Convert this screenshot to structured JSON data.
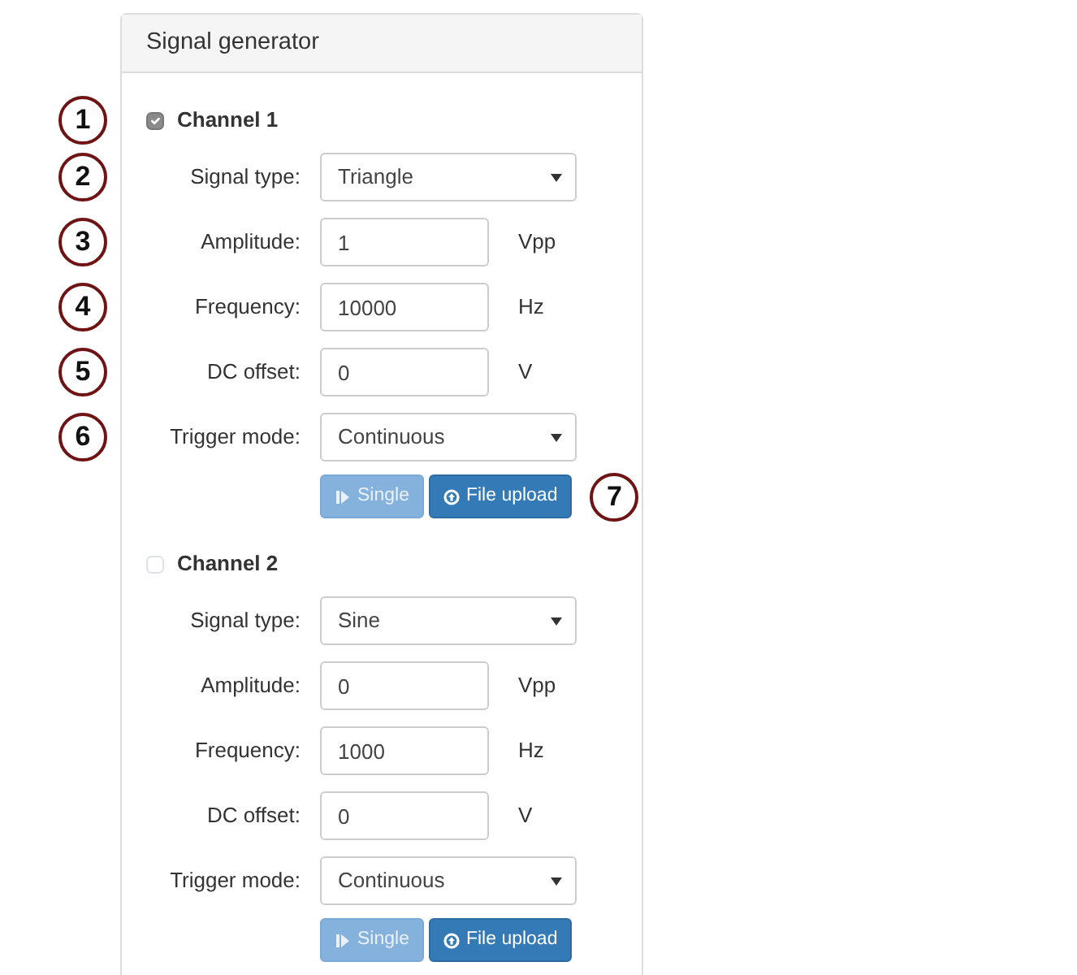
{
  "panel": {
    "title": "Signal generator"
  },
  "channels": [
    {
      "label": "Channel 1",
      "checked": true,
      "callout": "1",
      "fields": [
        {
          "kind": "select",
          "label": "Signal type:",
          "value": "Triangle",
          "callout": "2"
        },
        {
          "kind": "input",
          "label": "Amplitude:",
          "value": "1",
          "unit": "Vpp",
          "callout": "3"
        },
        {
          "kind": "input",
          "label": "Frequency:",
          "value": "10000",
          "unit": "Hz",
          "callout": "4"
        },
        {
          "kind": "input",
          "label": "DC offset:",
          "value": "0",
          "unit": "V",
          "callout": "5"
        },
        {
          "kind": "select",
          "label": "Trigger mode:",
          "value": "Continuous",
          "callout": "6"
        }
      ],
      "buttons": [
        {
          "kind": "single",
          "label": "Single",
          "disabled": true
        },
        {
          "kind": "upload",
          "label": "File upload",
          "disabled": false
        }
      ],
      "buttons_callout": "7"
    },
    {
      "label": "Channel 2",
      "checked": false,
      "fields": [
        {
          "kind": "select",
          "label": "Signal type:",
          "value": "Sine"
        },
        {
          "kind": "input",
          "label": "Amplitude:",
          "value": "0",
          "unit": "Vpp"
        },
        {
          "kind": "input",
          "label": "Frequency:",
          "value": "1000",
          "unit": "Hz"
        },
        {
          "kind": "input",
          "label": "DC offset:",
          "value": "0",
          "unit": "V"
        },
        {
          "kind": "select",
          "label": "Trigger mode:",
          "value": "Continuous"
        }
      ],
      "buttons": [
        {
          "kind": "single",
          "label": "Single",
          "disabled": true
        },
        {
          "kind": "upload",
          "label": "File upload",
          "disabled": false
        }
      ]
    }
  ]
}
